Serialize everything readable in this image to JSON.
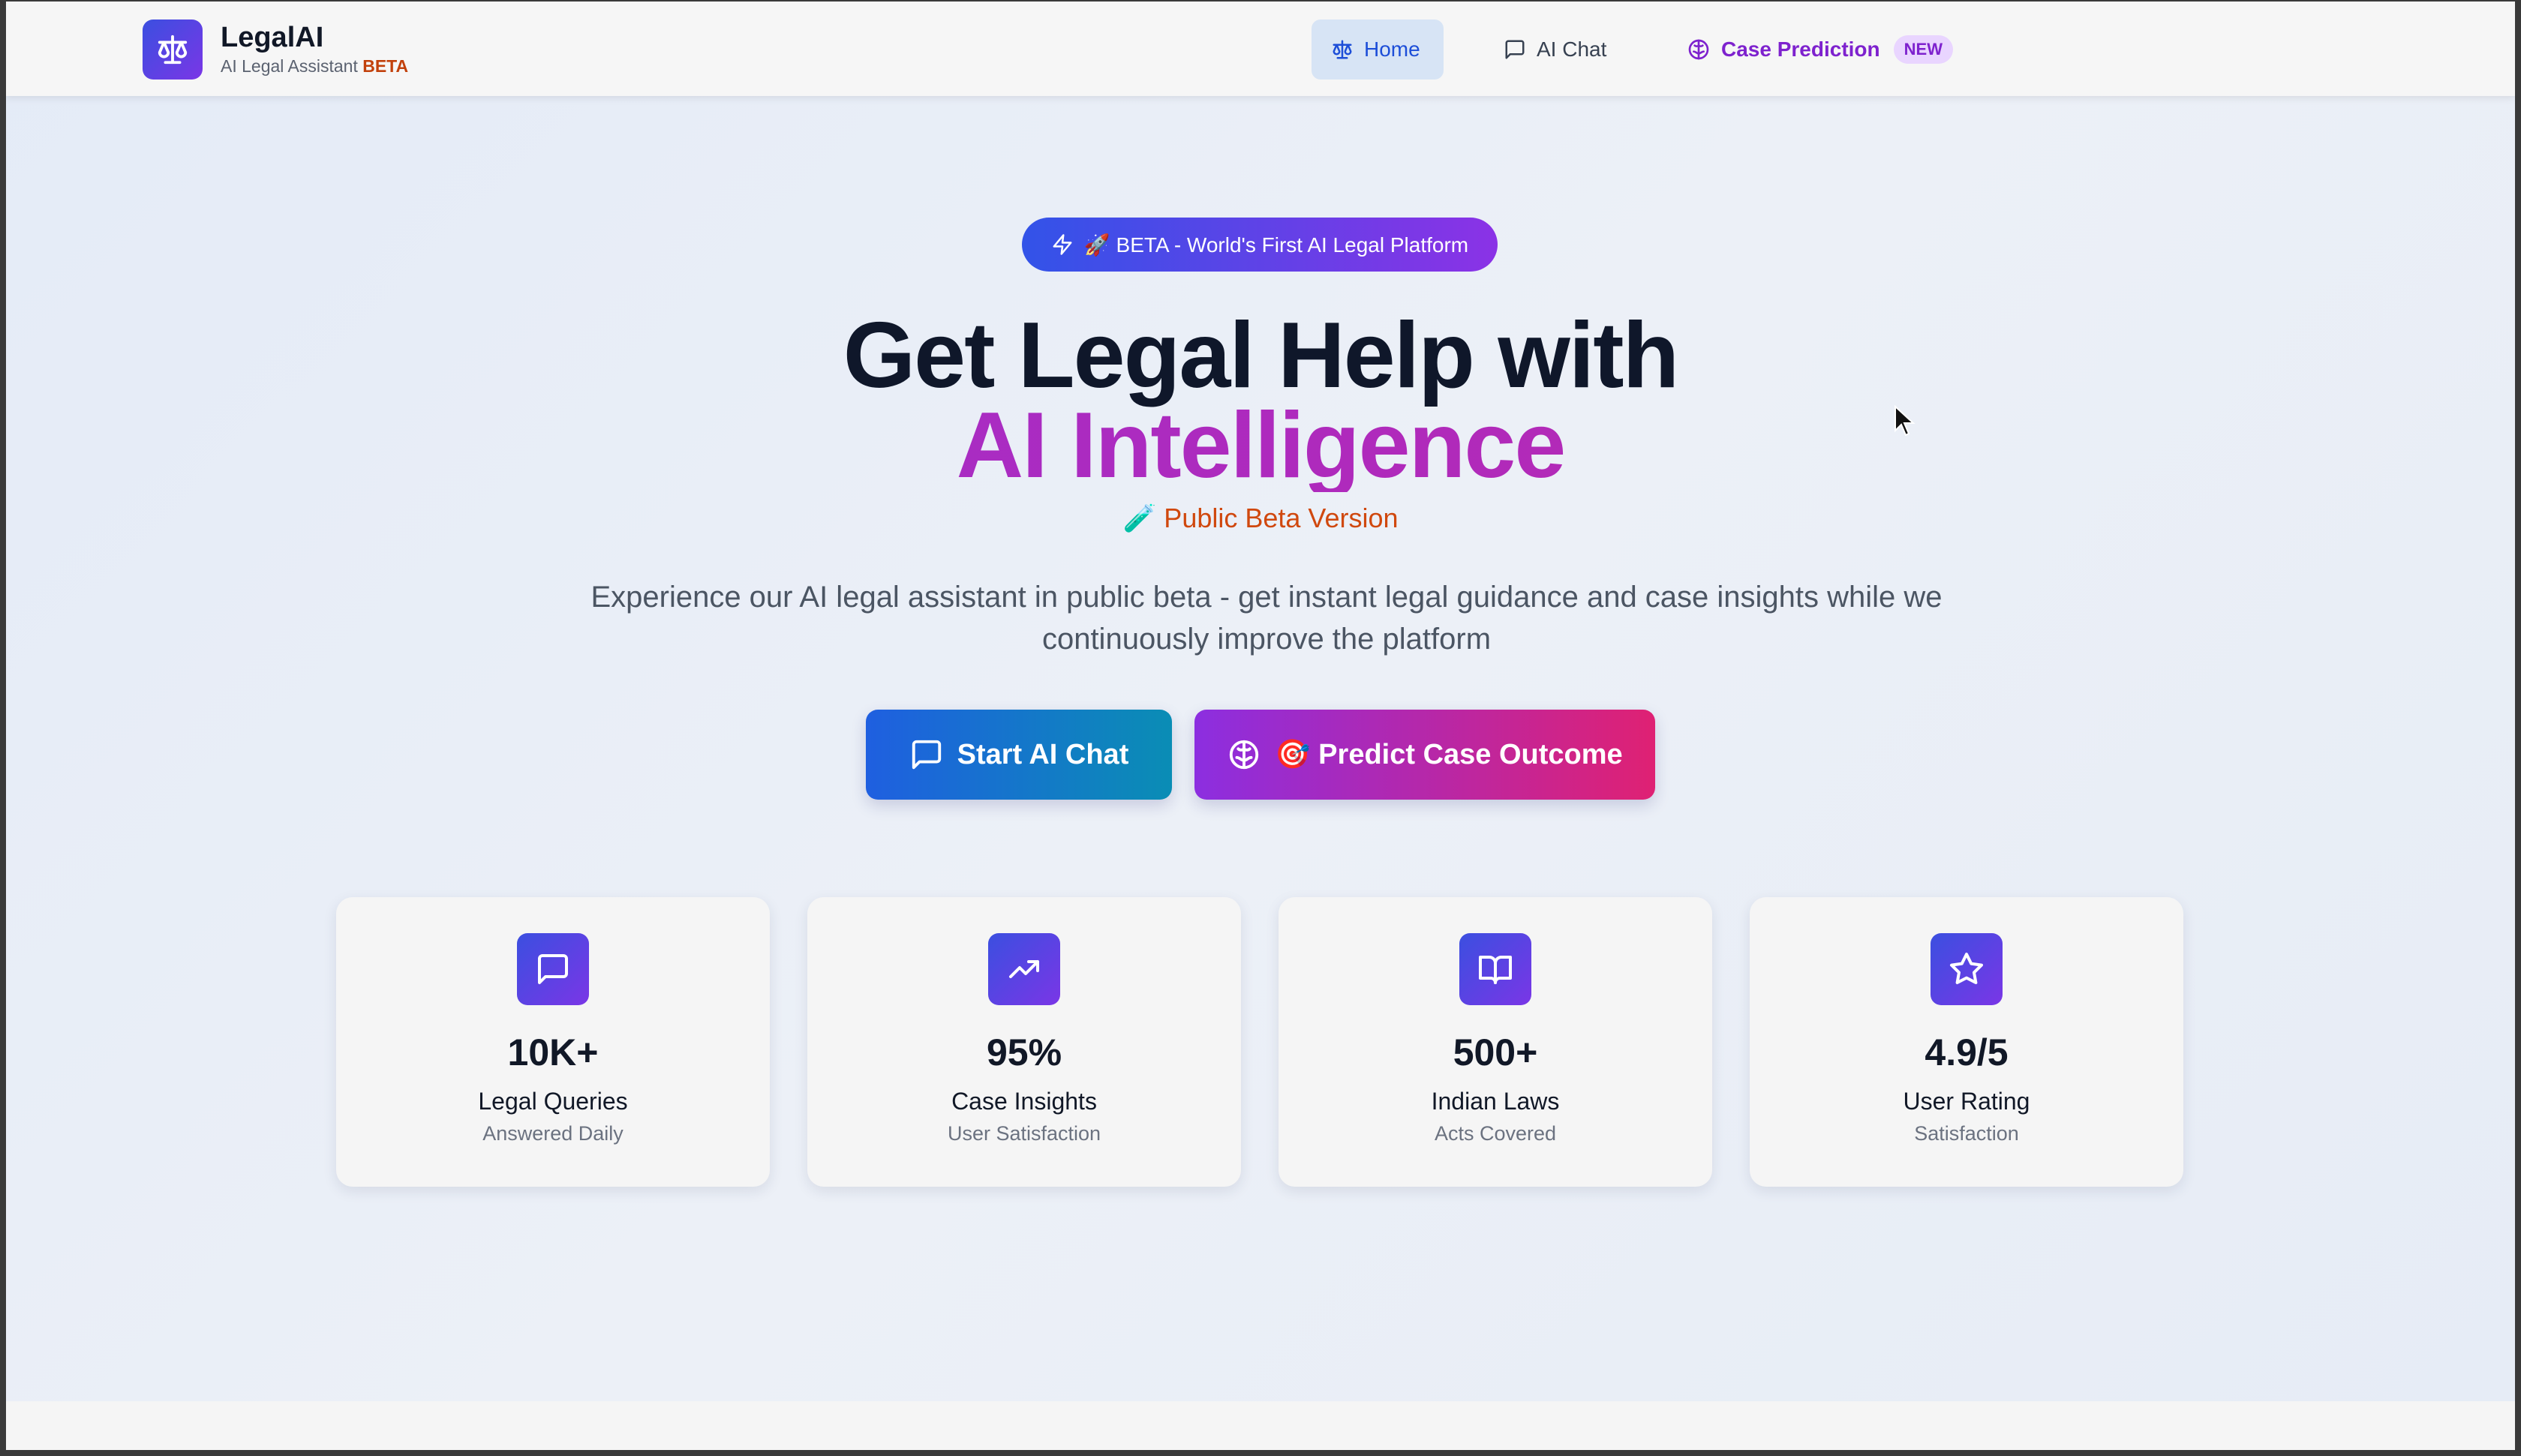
{
  "brand": {
    "name": "LegalAI",
    "subtitle": "AI Legal Assistant",
    "beta": "BETA",
    "icon": "scale-icon"
  },
  "nav": {
    "home": "Home",
    "chat": "AI Chat",
    "prediction": "Case Prediction",
    "prediction_badge": "NEW"
  },
  "hero": {
    "pill": "🚀 BETA - World's First AI Legal Platform",
    "title_line1": "Get Legal Help with",
    "title_line2": "AI Intelligence",
    "beta_version": "🧪 Public Beta Version",
    "description": "Experience our AI legal assistant in public beta - get instant legal guidance and case insights while we continuously improve the platform",
    "start_chat": "Start AI Chat",
    "predict": "🎯 Predict Case Outcome"
  },
  "stats": [
    {
      "value": "10K+",
      "label": "Legal Queries",
      "sub": "Answered Daily",
      "icon": "message-icon"
    },
    {
      "value": "95%",
      "label": "Case Insights",
      "sub": "User Satisfaction",
      "icon": "trending-up-icon"
    },
    {
      "value": "500+",
      "label": "Indian Laws",
      "sub": "Acts Covered",
      "icon": "book-icon"
    },
    {
      "value": "4.9/5",
      "label": "User Rating",
      "sub": "Satisfaction",
      "icon": "star-icon"
    }
  ],
  "colors": {
    "brand_gradient_start": "#3b4fe0",
    "brand_gradient_end": "#7a36e6",
    "beta_accent": "#c2410c",
    "prediction_accent": "#7e22ce"
  }
}
